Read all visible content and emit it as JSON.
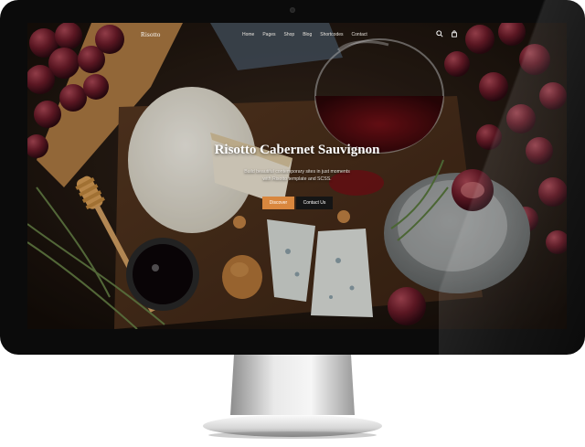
{
  "site": {
    "logo": "Risotto",
    "nav": [
      "Home",
      "Pages",
      "Shop",
      "Blog",
      "Shortcodes",
      "Contact"
    ],
    "icons": [
      "search-icon",
      "cart-icon"
    ]
  },
  "hero": {
    "title": "Risotto Cabernet Sauvignon",
    "subtitle_line1": "Build beautiful contemporary sites in just moments",
    "subtitle_line2": "with Risotto template and SCSS.",
    "primary_button": "Discover",
    "secondary_button": "Contact Us"
  },
  "colors": {
    "accent": "#d9873e",
    "bezel": "#0b0b0b",
    "dark_button": "#151515"
  }
}
